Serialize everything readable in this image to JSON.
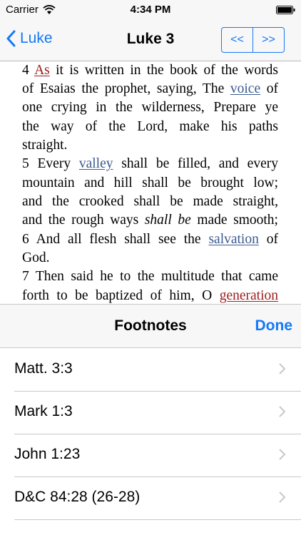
{
  "status_bar": {
    "carrier": "Carrier",
    "time": "4:34 PM"
  },
  "nav": {
    "back_label": "Luke",
    "title": "Luke 3",
    "prev_label": "<<",
    "next_label": ">>"
  },
  "scripture": {
    "l1a": "4 ",
    "l1b": "As",
    "l1c": " it is written in the book of the words",
    "l2a": "of Esaias the prophet, saying, The ",
    "l2b": "voice",
    "l2c": " of",
    "l3": "one crying in the wilderness, Prepare ye",
    "l4": "the way of the Lord, make his paths",
    "l5": "straight.",
    "l6a": "5 Every ",
    "l6b": "valley",
    "l6c": " shall be filled, and every",
    "l7": "mountain and hill shall be brought low;",
    "l8": "and the crooked shall be made straight,",
    "l9a": "and the rough ways ",
    "l9b": "shall be",
    "l9c": " made smooth;",
    "l10a": "6 And all flesh shall see the ",
    "l10b": "salvation",
    "l10c": " of",
    "l11": "God.",
    "l12": "7 Then said he to the multitude that came",
    "l13a": "forth to be baptized of him, O ",
    "l13b": "generation"
  },
  "footnotes": {
    "title": "Footnotes",
    "done_label": "Done",
    "items": [
      {
        "label": "Matt. 3:3"
      },
      {
        "label": "Mark 1:3"
      },
      {
        "label": "John 1:23"
      },
      {
        "label": "D&C 84:28 (26-28)"
      }
    ]
  },
  "colors": {
    "accent": "#1479f6",
    "footnote_red": "#9b1b1b",
    "footnote_blue": "#3a5a8e"
  }
}
